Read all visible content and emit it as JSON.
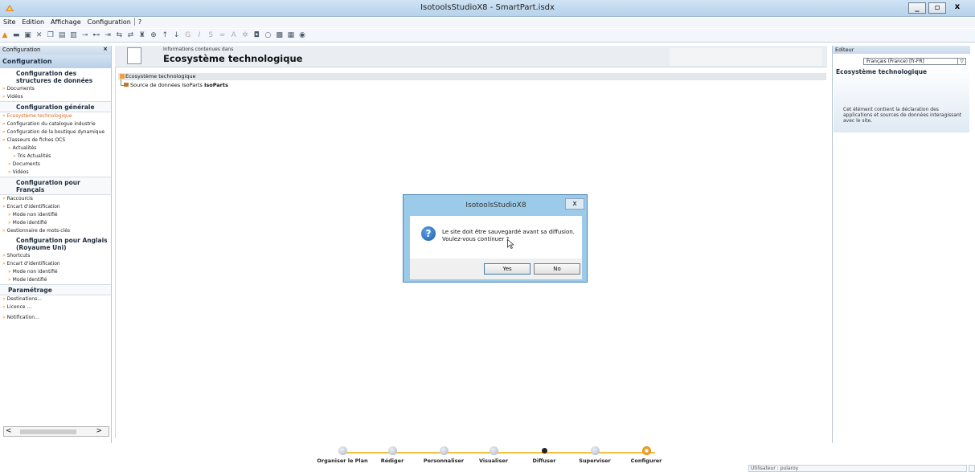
{
  "window": {
    "title": "IsotoolsStudioX8 - SmartPart.isdx",
    "controls": [
      "_",
      "▫",
      "x"
    ]
  },
  "menu": [
    "Site",
    "Edition",
    "Affichage",
    "Configuration",
    "?"
  ],
  "left_panel": {
    "header": "Configuration",
    "close": "×",
    "config_head": "Configuration",
    "sections": [
      {
        "title": "Configuration des structures de données",
        "items": [
          "Documents",
          "Vidéos"
        ]
      },
      {
        "title": "Configuration générale",
        "items": [
          "Ecosystème technologique",
          "Configuration du catalogue industrie",
          "Configuration de la boutique dynamique",
          "Classeurs de fiches OCS",
          "Actualités",
          "Tris Actualités",
          "Documents",
          "Vidéos"
        ]
      },
      {
        "title": "Configuration pour Français",
        "items": [
          "Raccourcis",
          "Encart d'identification",
          "Mode non identifié",
          "Mode identifié",
          "Gestionnaire de mots-clés"
        ]
      },
      {
        "title": "Configuration pour Anglais (Royaume Uni)",
        "items": [
          "Shortcuts",
          "Encart d'identification",
          "Mode non identifié",
          "Mode identifié"
        ]
      },
      {
        "title": "Paramétrage",
        "items": [
          "Destinations...",
          "Licence ...",
          "Notification..."
        ]
      }
    ]
  },
  "center": {
    "info_small": "Informations contenues dans",
    "info_title": "Ecosystème technologique",
    "tree_root": "Ecosystème technologique",
    "tree_child_prefix": "Source de données IsoParts",
    "tree_child_bold": "IsoParts"
  },
  "right_panel": {
    "header": "Editeur",
    "language": "Français (France) [fr-FR]",
    "title": "Ecosystème technologique",
    "description": "Cet élément contient la déclaration des applications et sources de données interagissant avec le site."
  },
  "dialog": {
    "title": "IsotoolsStudioX8",
    "close": "x",
    "message_line1": "Le site doit être sauvegardé avant sa diffusion.",
    "message_line2": "Voulez-vous continuer ?",
    "yes_label": "Yes",
    "no_label": "No",
    "icon": "question-icon"
  },
  "workflow": {
    "steps": [
      "Organiser le Plan",
      "Rédiger",
      "Personnaliser",
      "Visualiser",
      "Diffuser",
      "Superviser",
      "Configurer"
    ],
    "current_step": "Diffuser",
    "accent": "#f0c040"
  },
  "status": {
    "user": "Utilisateur : pularoy"
  },
  "colors": {
    "titlebar": "#c3daef",
    "dialog_frame": "#9ccbe9",
    "highlight": "#d9691f"
  }
}
